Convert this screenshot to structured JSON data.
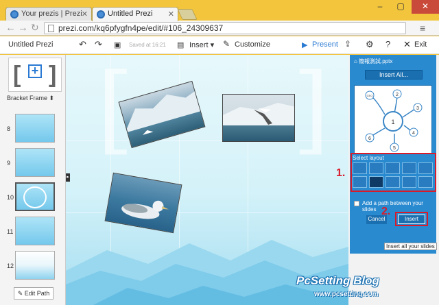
{
  "browser": {
    "tabs": [
      {
        "label": "Your prezis | Prezi"
      },
      {
        "label": "Untitled Prezi"
      }
    ],
    "url": "prezi.com/kq6pfygfn4pe/edit/#106_24309637",
    "window_controls": {
      "minimize": "–",
      "maximize": "▢",
      "close": "✕"
    }
  },
  "toolbar": {
    "title": "Untitled Prezi",
    "saved": "Saved at 16:21",
    "insert": "Insert",
    "customize": "Customize",
    "present": "Present",
    "exit": "Exit"
  },
  "sidebar": {
    "frame_label": "Bracket Frame",
    "slides": [
      "8",
      "9",
      "10",
      "11",
      "12"
    ],
    "edit_path": "Edit Path"
  },
  "panel": {
    "file": "簡報測試.pptx",
    "insert_all": "Insert All...",
    "diagram_nodes": [
      "1",
      "2",
      "3",
      "4",
      "5",
      "6",
      "CEO"
    ],
    "select_layout": "Select layout",
    "add_path": "Add a path between your slides",
    "cancel": "Cancel",
    "insert": "Insert",
    "tooltip": "Insert all your slides"
  },
  "annotations": {
    "step1": "1.",
    "step2": "2."
  },
  "watermark": {
    "title": "PcSetting Blog",
    "url": "www.pcsetting.com"
  },
  "colors": {
    "accent": "#2a7ad3",
    "panel": "#2a8ad0",
    "annotation": "#d81b2b",
    "frame": "#f2c53d"
  }
}
